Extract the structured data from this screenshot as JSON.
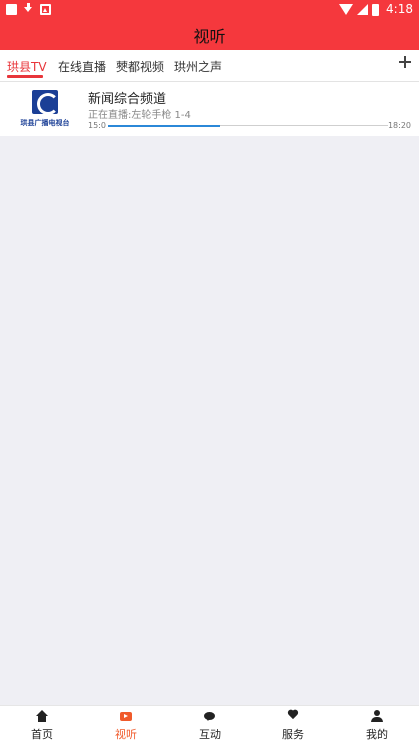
{
  "status_bar": {
    "time": "4:18"
  },
  "header": {
    "title": "视听"
  },
  "tabs": [
    {
      "label": "珙县TV",
      "active": true
    },
    {
      "label": "在线直播",
      "active": false
    },
    {
      "label": "僰都视频",
      "active": false
    },
    {
      "label": "珙州之声",
      "active": false
    }
  ],
  "channels": [
    {
      "logo_text": "珙县广播电视台",
      "name": "新闻综合频道",
      "now_playing": "正在直播:左轮手枪 1-4",
      "start_time": "15:0",
      "end_time": "18:20",
      "progress_percent": 40
    }
  ],
  "bottom_nav": [
    {
      "label": "首页",
      "icon": "home-icon",
      "active": false
    },
    {
      "label": "视听",
      "icon": "tv-icon",
      "active": true
    },
    {
      "label": "互动",
      "icon": "chat-icon",
      "active": false
    },
    {
      "label": "服务",
      "icon": "heart-icon",
      "active": false
    },
    {
      "label": "我的",
      "icon": "user-icon",
      "active": false
    }
  ],
  "colors": {
    "header": "#f5383d",
    "accent": "#e8353a",
    "nav_active": "#f05a2b",
    "progress": "#2b88d8"
  }
}
